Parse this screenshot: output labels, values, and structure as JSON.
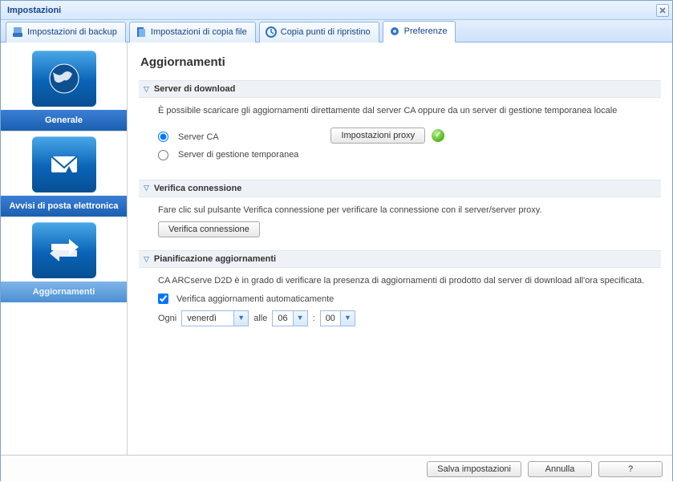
{
  "window": {
    "title": "Impostazioni"
  },
  "tabs": [
    {
      "label": "Impostazioni di backup"
    },
    {
      "label": "Impostazioni di copia file"
    },
    {
      "label": "Copia punti di ripristino"
    },
    {
      "label": "Preferenze"
    }
  ],
  "sidebar": {
    "items": [
      {
        "label": "Generale"
      },
      {
        "label": "Avvisi di posta elettronica"
      },
      {
        "label": "Aggiornamenti"
      }
    ]
  },
  "page": {
    "title": "Aggiornamenti"
  },
  "sections": {
    "download": {
      "heading": "Server di download",
      "desc": "È possibile scaricare gli aggiornamenti direttamente dal server CA oppure da un server di gestione temporanea locale",
      "radio_ca": "Server CA",
      "radio_staging": "Server di gestione temporanea",
      "proxy_btn": "Impostazioni proxy"
    },
    "test": {
      "heading": "Verifica connessione",
      "desc": "Fare clic sul pulsante Verifica connessione per verificare la connessione con il server/server proxy.",
      "btn": "Verifica connessione"
    },
    "schedule": {
      "heading": "Pianificazione aggiornamenti",
      "desc": "CA ARCserve D2D è in grado di verificare la presenza di aggiornamenti di prodotto dal server di download all'ora specificata.",
      "auto_label": "Verifica aggiornamenti automaticamente",
      "every": "Ogni",
      "at": "alle",
      "colon": ":",
      "day": "venerdì",
      "hour": "06",
      "minute": "00"
    }
  },
  "footer": {
    "save": "Salva impostazioni",
    "cancel": "Annulla",
    "help": "?"
  }
}
